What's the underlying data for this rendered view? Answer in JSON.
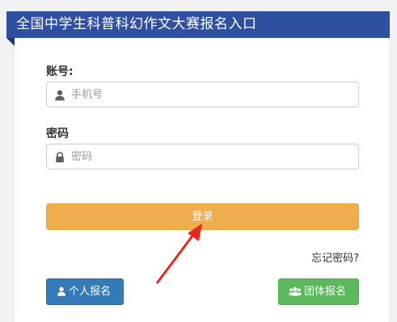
{
  "header": {
    "title": "全国中学生科普科幻作文大赛报名入口"
  },
  "form": {
    "account_label": "账号:",
    "account_placeholder": "手机号",
    "password_label": "密码",
    "password_placeholder": "密码",
    "login_label": "登录",
    "forgot_label": "忘记密码?"
  },
  "actions": {
    "personal_label": "个人报名",
    "group_label": "团体报名"
  },
  "colors": {
    "header": "#2f4fa0",
    "login": "#efad4d",
    "personal": "#337ab7",
    "group": "#5cb85c",
    "annotation_arrow": "#e8261e"
  },
  "icons": [
    "user-icon",
    "lock-icon",
    "users-icon"
  ]
}
